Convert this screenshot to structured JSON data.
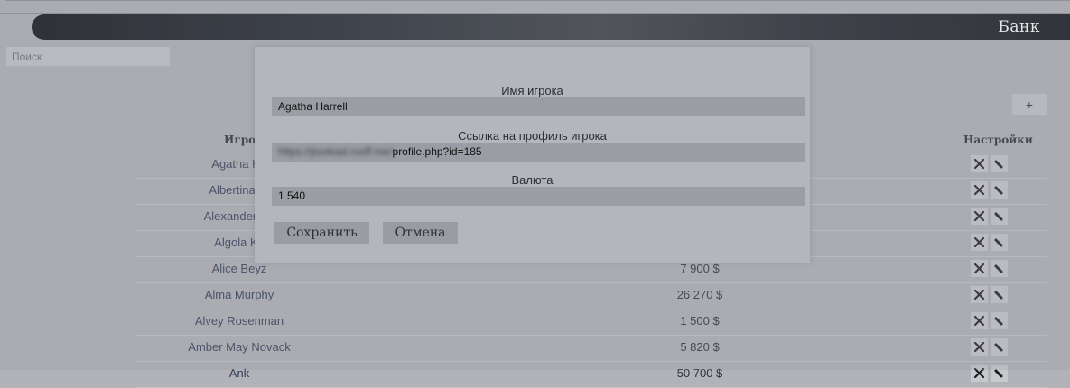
{
  "header": {
    "title": "Банк"
  },
  "search": {
    "placeholder": "Поиск"
  },
  "toolbar": {
    "add_label": "+"
  },
  "table": {
    "columns": {
      "player": "Игрок",
      "settings": "Настройки"
    },
    "rows": [
      {
        "name": "Agatha Ha",
        "amount": ""
      },
      {
        "name": "Albertina Di",
        "amount": ""
      },
      {
        "name": "Alexander Ne",
        "amount": ""
      },
      {
        "name": "Algola Ka",
        "amount": ""
      },
      {
        "name": "Alice Beyz",
        "amount": "7 900 $"
      },
      {
        "name": "Alma Murphy",
        "amount": "26 270 $"
      },
      {
        "name": "Alvey Rosenman",
        "amount": "1 500 $"
      },
      {
        "name": "Amber May Novack",
        "amount": "5 820 $"
      },
      {
        "name": "Ank",
        "amount": "50 700 $"
      }
    ]
  },
  "modal": {
    "name_label": "Имя игрока",
    "name_value": "Agatha Harrell",
    "link_label": "Ссылка на профиль игрока",
    "link_value_hidden": "https://jisolead.rusff.me/",
    "link_value_visible": "profile.php?id=185",
    "currency_label": "Валюта",
    "currency_value": "1 540",
    "save_label": "Сохранить",
    "cancel_label": "Отмена"
  },
  "icons": {
    "delete": "close-icon",
    "edit": "pencil-icon"
  }
}
